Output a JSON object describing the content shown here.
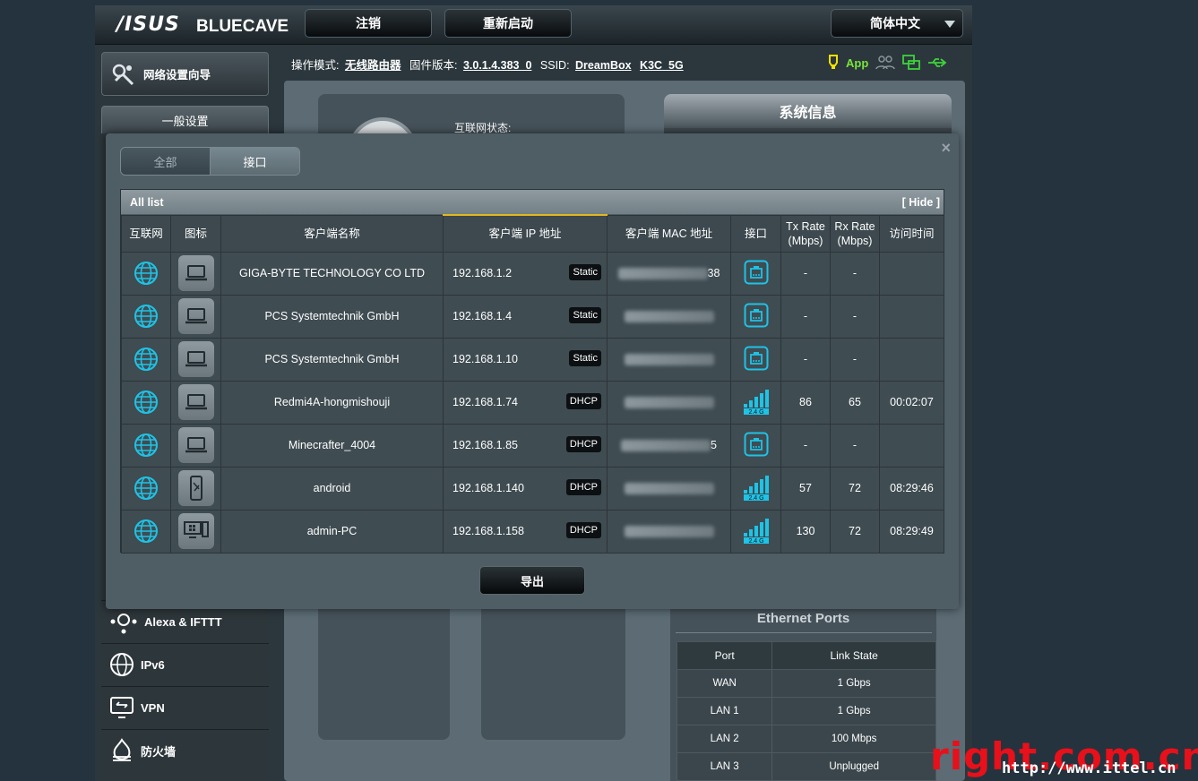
{
  "header": {
    "logo": "/ISUS",
    "model": "BLUECAVE",
    "logout_label": "注销",
    "reboot_label": "重新启动",
    "language": "简体中文"
  },
  "statusline": {
    "mode_label": "操作模式:",
    "mode_value": "无线路由器",
    "fw_label": "固件版本:",
    "fw_value": "3.0.1.4.383_0",
    "ssid_label": "SSID:",
    "ssid_1": "DreamBox",
    "ssid_2": "K3C_5G",
    "app_label": "App"
  },
  "sidebar": {
    "wizard_label": "网络设置向导",
    "general_label": "一般设置",
    "items": [
      {
        "label": "Alexa & IFTTT"
      },
      {
        "label": "IPv6"
      },
      {
        "label": "VPN"
      },
      {
        "label": "防火墙"
      }
    ]
  },
  "background": {
    "internet_status_label": "互联网状态:",
    "sysinfo_title": "系统信息",
    "eth_title": "Ethernet Ports",
    "eth_headers": [
      "Port",
      "Link State"
    ],
    "eth_rows": [
      [
        "WAN",
        "1 Gbps"
      ],
      [
        "LAN 1",
        "1 Gbps"
      ],
      [
        "LAN 2",
        "100 Mbps"
      ],
      [
        "LAN 3",
        "Unplugged"
      ]
    ]
  },
  "modal": {
    "close": "×",
    "tab_all": "全部",
    "tab_port": "接口",
    "list_title": "All list",
    "hide_label": "[ Hide ]",
    "export_label": "导出",
    "columns": [
      "互联网",
      "图标",
      "客户端名称",
      "客户端 IP 地址",
      "客户端 MAC 地址",
      "接口",
      "Tx Rate (Mbps)",
      "Rx Rate (Mbps)",
      "访问时间"
    ],
    "rows": [
      {
        "name": "GIGA-BYTE TECHNOLOGY CO LTD",
        "ip": "192.168.1.2",
        "ip_type": "Static",
        "mac_visible": "38",
        "iface": "wired",
        "device": "laptop",
        "tx": "-",
        "rx": "-",
        "time": ""
      },
      {
        "name": "PCS Systemtechnik GmbH",
        "ip": "192.168.1.4",
        "ip_type": "Static",
        "mac_visible": "",
        "iface": "wired",
        "device": "laptop",
        "tx": "-",
        "rx": "-",
        "time": ""
      },
      {
        "name": "PCS Systemtechnik GmbH",
        "ip": "192.168.1.10",
        "ip_type": "Static",
        "mac_visible": "",
        "iface": "wired",
        "device": "laptop",
        "tx": "-",
        "rx": "-",
        "time": ""
      },
      {
        "name": "Redmi4A-hongmishouji",
        "ip": "192.168.1.74",
        "ip_type": "DHCP",
        "mac_visible": "",
        "iface": "2.4 G",
        "device": "laptop",
        "tx": "86",
        "rx": "65",
        "time": "00:02:07"
      },
      {
        "name": "Minecrafter_4004",
        "ip": "192.168.1.85",
        "ip_type": "DHCP",
        "mac_visible": "5",
        "iface": "wired",
        "device": "laptop",
        "tx": "-",
        "rx": "-",
        "time": ""
      },
      {
        "name": "android",
        "ip": "192.168.1.140",
        "ip_type": "DHCP",
        "mac_visible": "",
        "iface": "2.4 G",
        "device": "phone",
        "tx": "57",
        "rx": "72",
        "time": "08:29:46"
      },
      {
        "name": "admin-PC",
        "ip": "192.168.1.158",
        "ip_type": "DHCP",
        "mac_visible": "",
        "iface": "2.4 G",
        "device": "windows-pc",
        "tx": "130",
        "rx": "72",
        "time": "08:29:49"
      }
    ]
  },
  "watermark": {
    "line1": "right.com.cn",
    "line2": "http://www.ittel.cn"
  },
  "colors": {
    "accent_cyan": "#1ec3e6",
    "app_green": "#79e53a",
    "sort_yellow": "#e3b81e"
  }
}
